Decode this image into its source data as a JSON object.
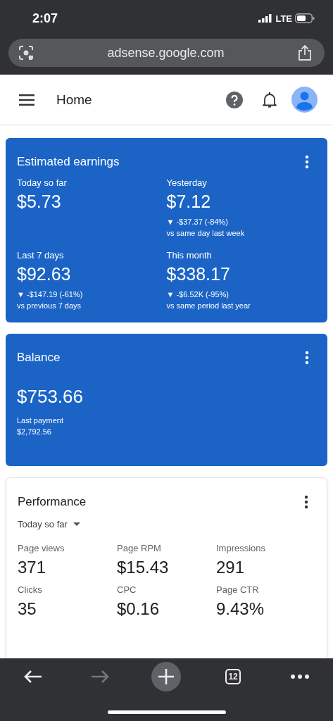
{
  "status_bar": {
    "time": "2:07",
    "network": "LTE"
  },
  "browser": {
    "url": "adsense.google.com"
  },
  "header": {
    "title": "Home"
  },
  "earnings": {
    "title": "Estimated earnings",
    "periods": [
      {
        "label": "Today so far",
        "value": "$5.73"
      },
      {
        "label": "Yesterday",
        "value": "$7.12",
        "change": "▼ -$37.37 (-84%)",
        "comparison": "vs same day last week"
      },
      {
        "label": "Last 7 days",
        "value": "$92.63",
        "change": "▼ -$147.19 (-61%)",
        "comparison": "vs previous 7 days"
      },
      {
        "label": "This month",
        "value": "$338.17",
        "change": "▼ -$6.52K (-95%)",
        "comparison": "vs same period last year"
      }
    ]
  },
  "balance": {
    "title": "Balance",
    "value": "$753.66",
    "last_payment_label": "Last payment",
    "last_payment": "$2,792.56"
  },
  "performance": {
    "title": "Performance",
    "range": "Today so far",
    "metrics": [
      {
        "label": "Page views",
        "value": "371"
      },
      {
        "label": "Page RPM",
        "value": "$15.43"
      },
      {
        "label": "Impressions",
        "value": "291"
      },
      {
        "label": "Clicks",
        "value": "35"
      },
      {
        "label": "CPC",
        "value": "$0.16"
      },
      {
        "label": "Page CTR",
        "value": "9.43%"
      }
    ]
  },
  "toolbar": [
    {
      "kind": "back",
      "disabled": false
    },
    {
      "kind": "forward",
      "disabled": true
    },
    {
      "kind": "new_tab"
    },
    {
      "kind": "tabs",
      "label": "12"
    },
    {
      "kind": "more"
    }
  ]
}
